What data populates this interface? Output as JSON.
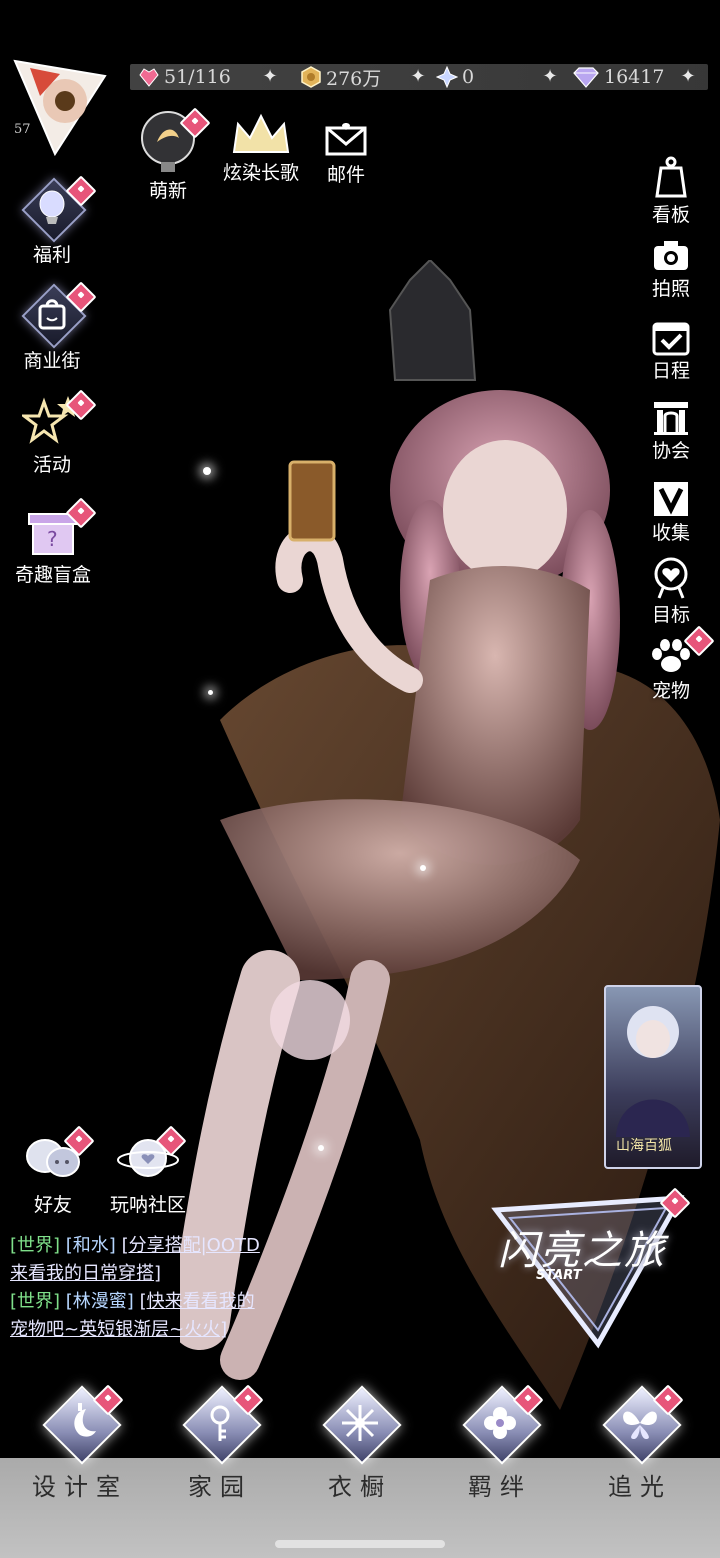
{
  "currency": {
    "stamina": "51/116",
    "gold": "276万",
    "crystal": "0",
    "diamond": "16417"
  },
  "player": {
    "level": "57"
  },
  "top_buttons": [
    {
      "label": "萌新"
    },
    {
      "label": "炫染长歌"
    },
    {
      "label": "邮件"
    }
  ],
  "left_menu": [
    {
      "label": "福利"
    },
    {
      "label": "商业街"
    },
    {
      "label": "活动"
    },
    {
      "label": "奇趣盲盒"
    }
  ],
  "right_menu": [
    {
      "label": "看板"
    },
    {
      "label": "拍照"
    },
    {
      "label": "日程"
    },
    {
      "label": "协会"
    },
    {
      "label": "收集"
    },
    {
      "label": "目标"
    },
    {
      "label": "宠物"
    }
  ],
  "social": [
    {
      "label": "好友"
    },
    {
      "label": "玩呐社区"
    }
  ],
  "chat": [
    {
      "channel": "[世界]",
      "name": "[和水]",
      "msg": "[分享搭配|OOTD",
      "msg2": "来看我的日常穿搭]"
    },
    {
      "channel": "[世界]",
      "name": "[林漫蜜]",
      "msg": "[快来看看我的",
      "msg2": "宠物吧~英短银渐层~火火]"
    }
  ],
  "start": {
    "main": "闪亮之旅",
    "sub": "START"
  },
  "event_card": {
    "label": "山海百狐"
  },
  "bottom_nav": [
    {
      "label": "设计室"
    },
    {
      "label": "家园"
    },
    {
      "label": "衣橱"
    },
    {
      "label": "羁绊"
    },
    {
      "label": "追光"
    }
  ],
  "colors": {
    "badge": "#e7557a",
    "chat_channel": "#7fe08a",
    "chat_name": "#b6d6ff"
  }
}
